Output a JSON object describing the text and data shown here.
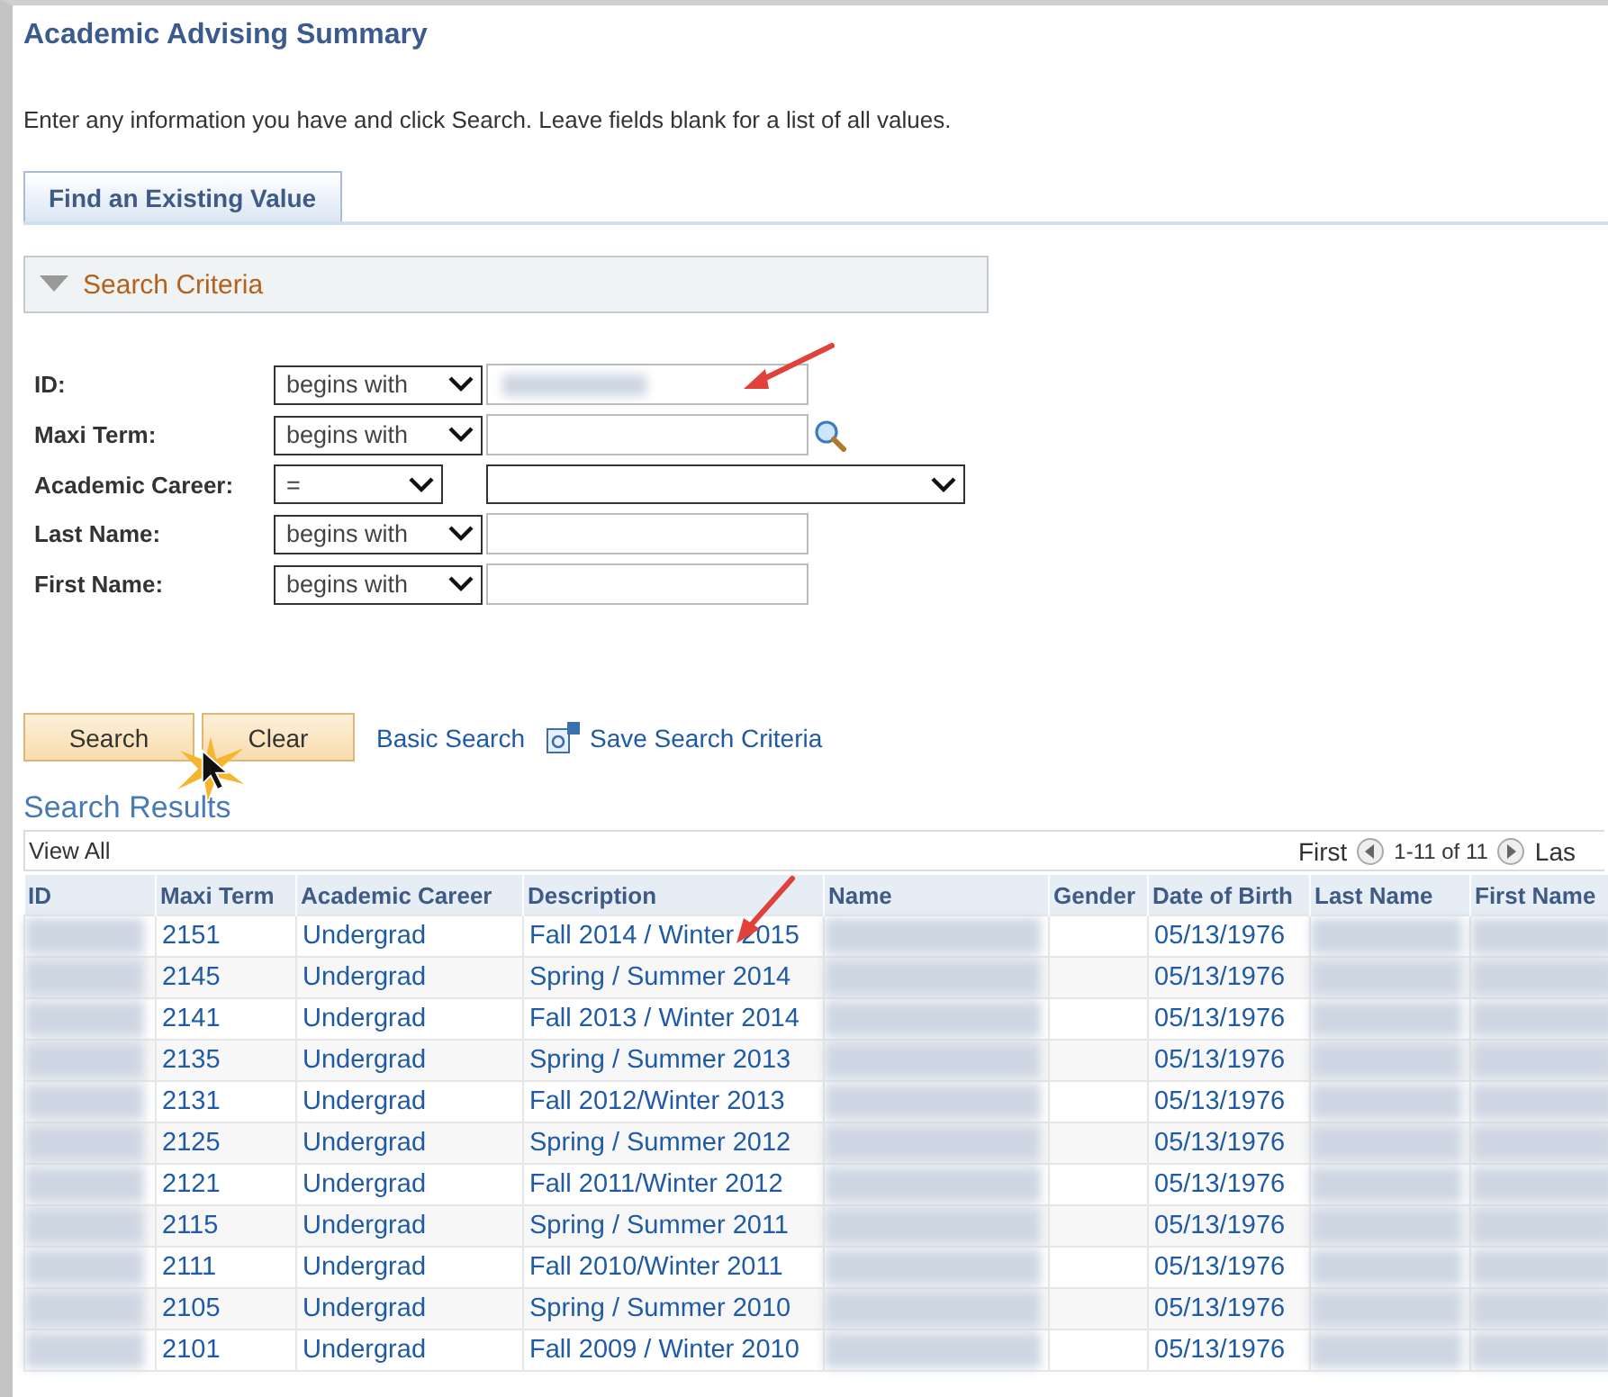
{
  "page_title": "Academic Advising Summary",
  "instructions": "Enter any information you have and click Search. Leave fields blank for a list of all values.",
  "tabs": [
    {
      "label": "Find an Existing Value",
      "selected": true
    }
  ],
  "section": {
    "title": "Search Criteria",
    "expanded": true
  },
  "fields": [
    {
      "label": "ID:",
      "operator": "begins with",
      "kind": "text",
      "redacted": true
    },
    {
      "label": "Maxi Term:",
      "operator": "begins with",
      "kind": "lookup",
      "redacted": false
    },
    {
      "label": "Academic Career:",
      "operator": "=",
      "kind": "select",
      "redacted": false
    },
    {
      "label": "Last Name:",
      "operator": "begins with",
      "kind": "text",
      "redacted": false
    },
    {
      "label": "First Name:",
      "operator": "begins with",
      "kind": "text",
      "redacted": false
    }
  ],
  "buttons": [
    "Search",
    "Clear"
  ],
  "links": [
    {
      "label": "Basic Search",
      "kind": "plain"
    },
    {
      "label": "Save Search Criteria",
      "kind": "save"
    }
  ],
  "results": {
    "title": "Search Results",
    "view_all": "View All",
    "first": "First",
    "range": "1-11 of 11",
    "last": "Las",
    "columns": [
      "ID",
      "Maxi Term",
      "Academic Career",
      "Description",
      "Name",
      "Gender",
      "Date of Birth",
      "Last Name",
      "First Name"
    ],
    "rows": [
      {
        "maxi_term": "2151",
        "career": "Undergrad",
        "description": "Fall 2014 / Winter 2015",
        "dob": "05/13/1976"
      },
      {
        "maxi_term": "2145",
        "career": "Undergrad",
        "description": "Spring / Summer 2014",
        "dob": "05/13/1976"
      },
      {
        "maxi_term": "2141",
        "career": "Undergrad",
        "description": "Fall 2013 / Winter 2014",
        "dob": "05/13/1976"
      },
      {
        "maxi_term": "2135",
        "career": "Undergrad",
        "description": "Spring / Summer 2013",
        "dob": "05/13/1976"
      },
      {
        "maxi_term": "2131",
        "career": "Undergrad",
        "description": "Fall 2012/Winter 2013",
        "dob": "05/13/1976"
      },
      {
        "maxi_term": "2125",
        "career": "Undergrad",
        "description": "Spring / Summer 2012",
        "dob": "05/13/1976"
      },
      {
        "maxi_term": "2121",
        "career": "Undergrad",
        "description": "Fall 2011/Winter 2012",
        "dob": "05/13/1976"
      },
      {
        "maxi_term": "2115",
        "career": "Undergrad",
        "description": "Spring / Summer 2011",
        "dob": "05/13/1976"
      },
      {
        "maxi_term": "2111",
        "career": "Undergrad",
        "description": "Fall 2010/Winter 2011",
        "dob": "05/13/1976"
      },
      {
        "maxi_term": "2105",
        "career": "Undergrad",
        "description": "Spring / Summer 2010",
        "dob": "05/13/1976"
      },
      {
        "maxi_term": "2101",
        "career": "Undergrad",
        "description": "Fall 2009 / Winter 2010",
        "dob": "05/13/1976"
      }
    ]
  }
}
